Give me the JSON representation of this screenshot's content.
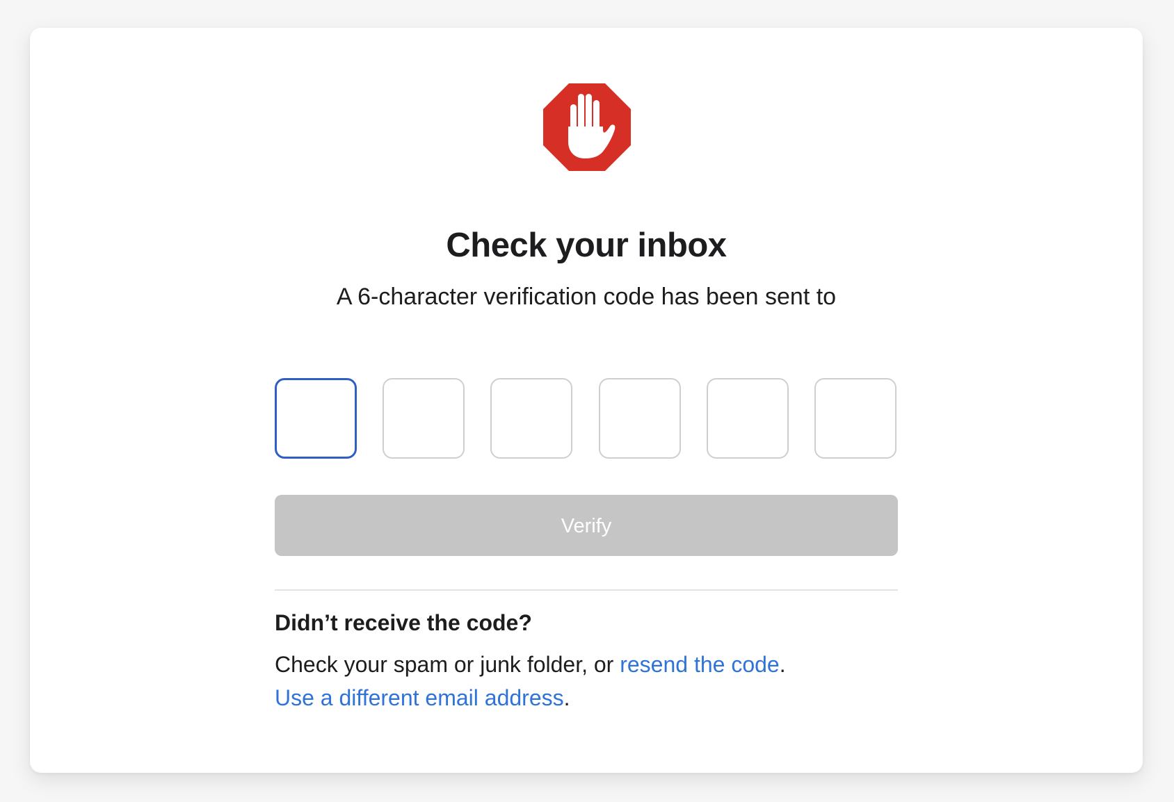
{
  "colors": {
    "brand_red": "#d63026",
    "link_blue": "#2f73d9",
    "active_border": "#2f5fc4",
    "disabled_button": "#c5c5c5"
  },
  "logo": {
    "icon": "stop-hand-icon"
  },
  "header": {
    "title": "Check your inbox",
    "subtitle": "A 6-character verification code has been sent to"
  },
  "code": {
    "length": 6,
    "values": [
      "",
      "",
      "",
      "",
      "",
      ""
    ],
    "active_index": 0
  },
  "verify_button": {
    "label": "Verify",
    "disabled": true
  },
  "help": {
    "heading": "Didn’t receive the code?",
    "line1_prefix": "Check your spam or junk folder, or ",
    "resend_link": "resend the code",
    "line1_suffix": ".",
    "different_email_link": "Use a different email address",
    "line2_suffix": "."
  }
}
